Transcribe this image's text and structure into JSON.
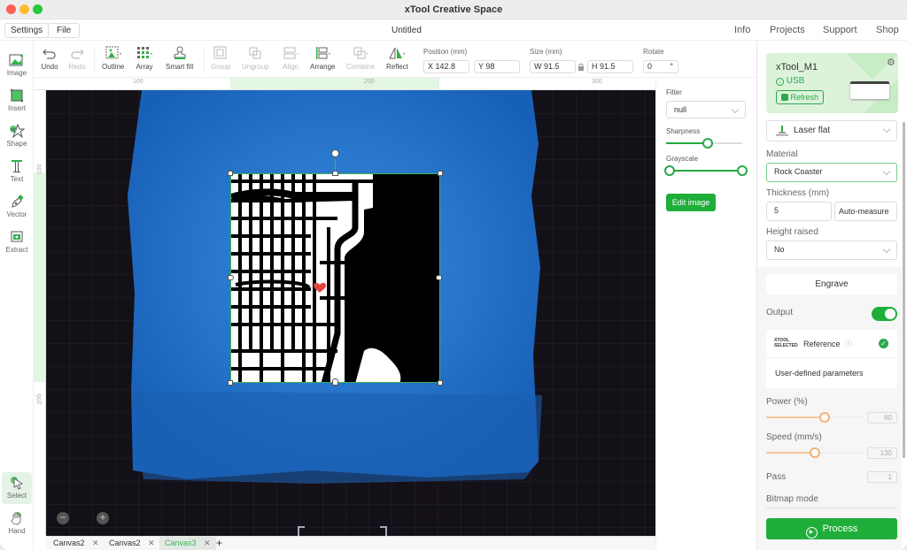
{
  "window": {
    "title": "xTool Creative Space",
    "document_title": "Untitled"
  },
  "menu": {
    "settings": "Settings",
    "file": "File"
  },
  "nav": [
    "Info",
    "Projects",
    "Support",
    "Shop"
  ],
  "left_tools": [
    {
      "label": "Image",
      "icon": "image-icon"
    },
    {
      "label": "Insert",
      "icon": "insert-icon"
    },
    {
      "label": "Shape",
      "icon": "shape-icon"
    },
    {
      "label": "Text",
      "icon": "text-icon"
    },
    {
      "label": "Vector",
      "icon": "vector-pen-icon"
    },
    {
      "label": "Extract",
      "icon": "extract-icon"
    },
    {
      "label": "Select",
      "icon": "select-cursor-icon",
      "active": true
    },
    {
      "label": "Hand",
      "icon": "hand-icon"
    }
  ],
  "toolbar": {
    "undo": "Undo",
    "redo": "Redo",
    "outline": "Outline",
    "array": "Array",
    "smart_fill": "Smart fill",
    "group": "Group",
    "ungroup": "Ungroup",
    "align": "Align",
    "arrange": "Arrange",
    "combine": "Combine",
    "reflect": "Reflect",
    "position_label": "Position (mm)",
    "x_value": "X 142.8",
    "y_value": "Y 98",
    "size_label": "Size (mm)",
    "w_value": "W 91.5",
    "h_value": "H 91.5",
    "rotate_label": "Rotate",
    "rotate_value": "0",
    "rotate_unit": "°"
  },
  "rulers": {
    "top": [
      "100",
      "200",
      "300"
    ],
    "left": [
      "100",
      "200"
    ]
  },
  "canvas_tabs": [
    {
      "label": "Canvas2",
      "active": false
    },
    {
      "label": "Canvas2",
      "active": false
    },
    {
      "label": "Canvas3",
      "active": true
    }
  ],
  "add_tab": "+",
  "image_props": {
    "filter_label": "Filter",
    "filter_value": "null",
    "sharpness_label": "Sharpness",
    "sharpness_value": 0.55,
    "grayscale_label": "Grayscale",
    "grayscale_range": [
      0,
      1
    ],
    "edit_image": "Edit image"
  },
  "device": {
    "name": "xTool_M1",
    "connection": "USB",
    "refresh": "Refresh"
  },
  "laser": {
    "mode": "Laser flat",
    "material_label": "Material",
    "material_value": "Rock Coaster",
    "thickness_label": "Thickness (mm)",
    "thickness_value": "5",
    "auto_measure": "Auto-measure",
    "height_label": "Height raised",
    "height_value": "No",
    "engrave": "Engrave",
    "output_label": "Output",
    "output_on": true,
    "reference_brand": "XTOOL SELECTED",
    "reference_label": "Reference",
    "user_defined": "User-defined parameters",
    "power_label": "Power (%)",
    "power_value": "60",
    "speed_label": "Speed (mm/s)",
    "speed_value": "130",
    "pass_label": "Pass",
    "pass_value": "1",
    "bitmap_label": "Bitmap mode",
    "process": "Process"
  },
  "colors": {
    "accent": "#1fae3a",
    "tape": "#1f73d0",
    "power_slider": "#f2b27a"
  }
}
